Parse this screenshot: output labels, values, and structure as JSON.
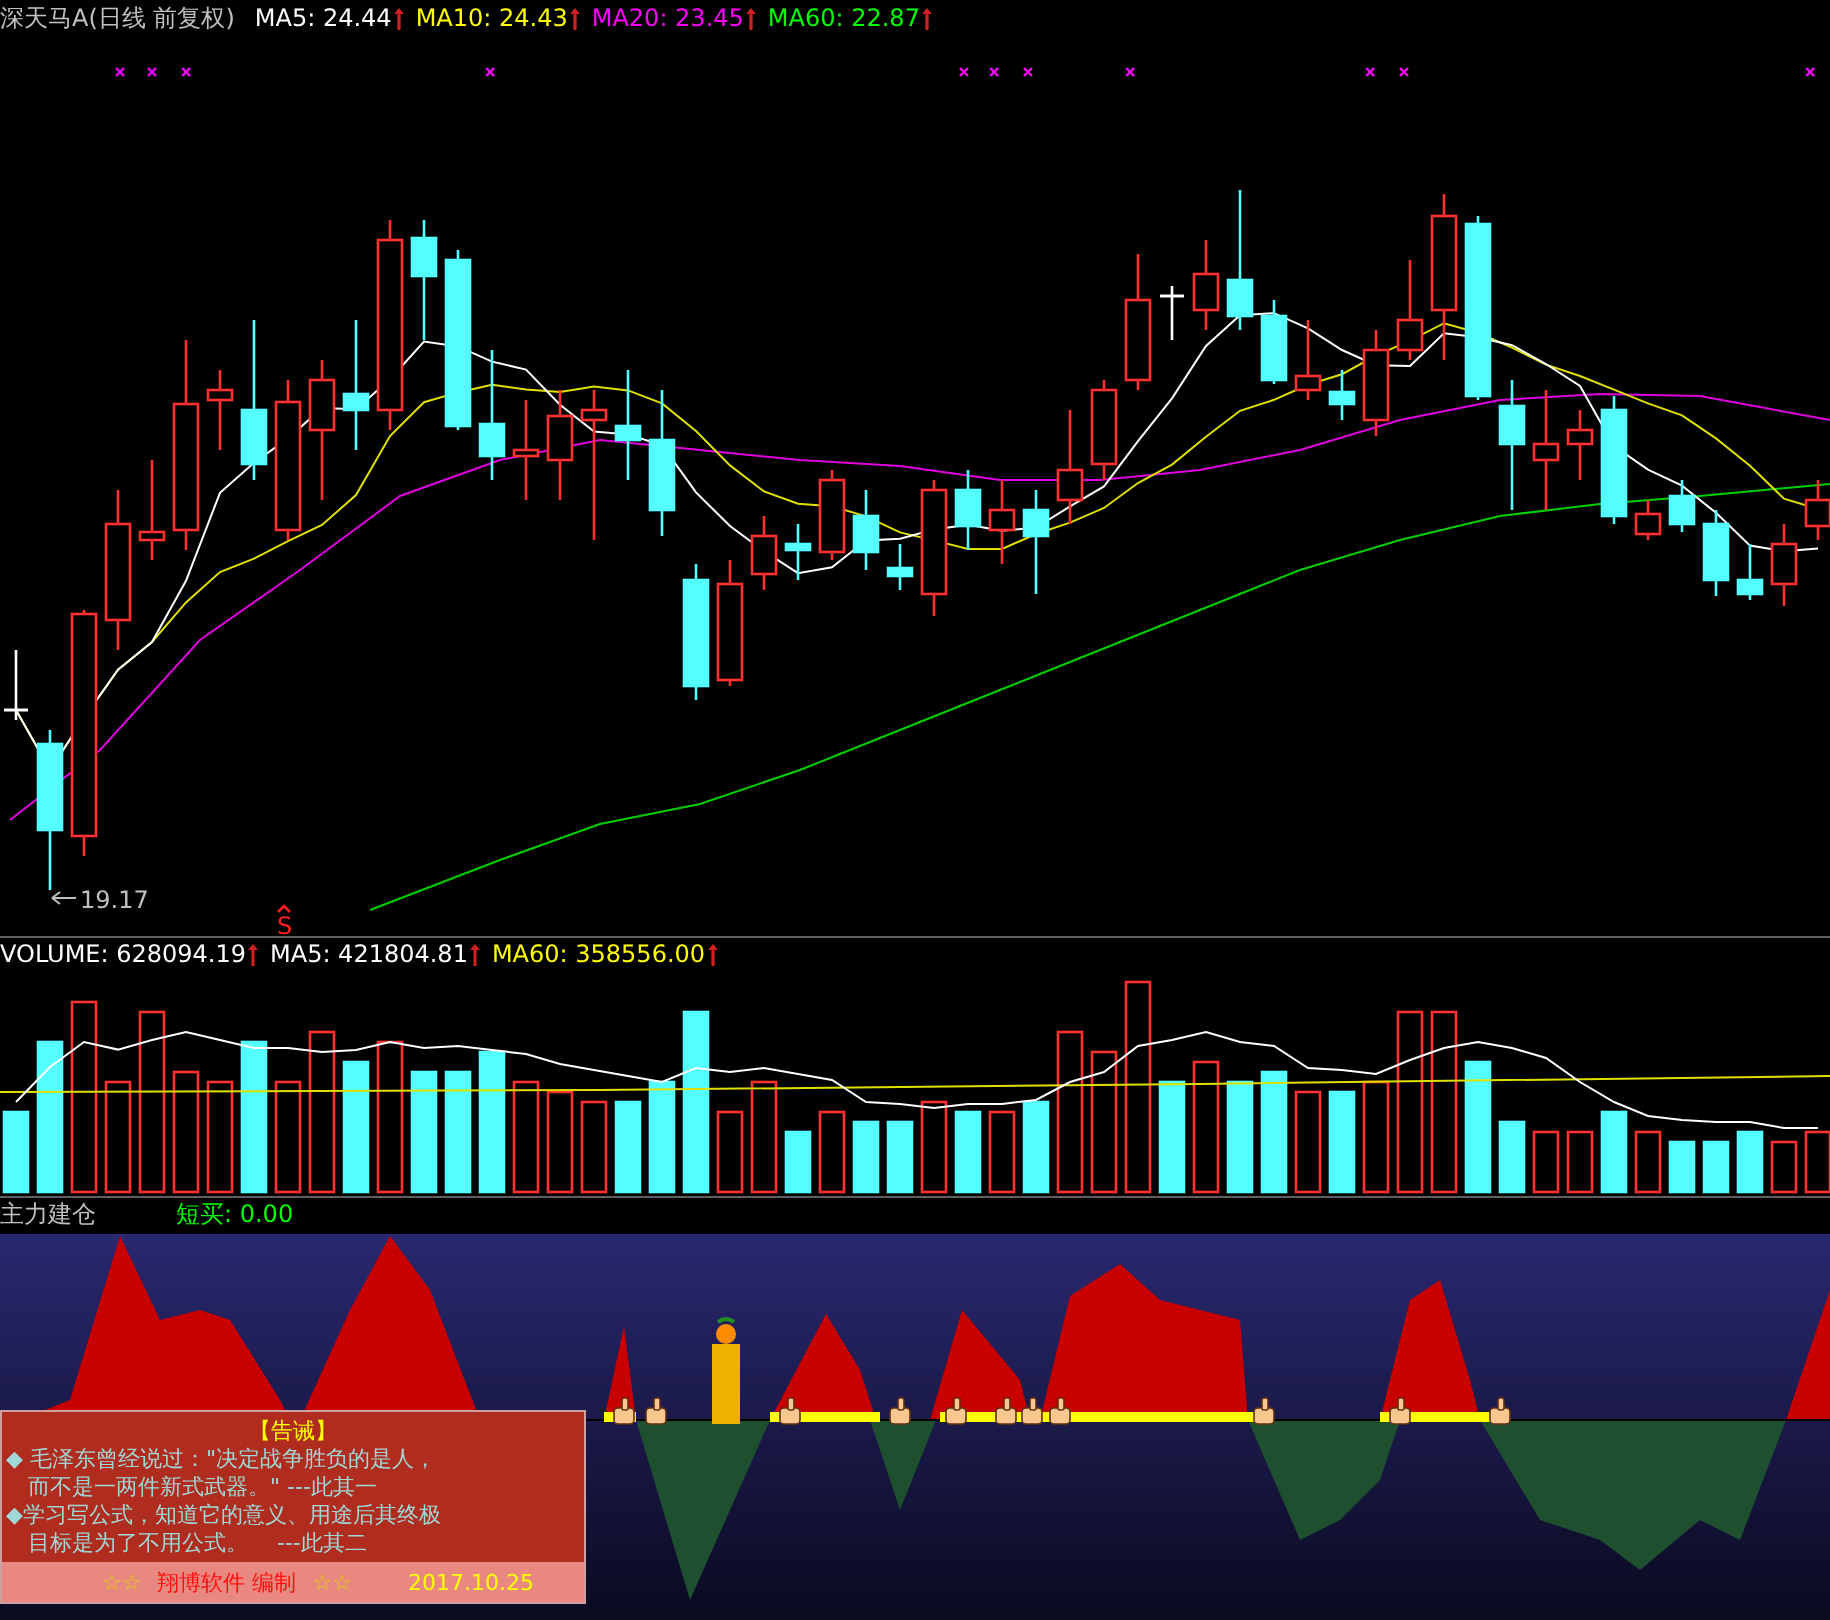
{
  "header": {
    "title": "深天马A(日线 前复权)",
    "averages": [
      {
        "label": "MA5: 24.44",
        "color": "#ffffff"
      },
      {
        "label": "MA10: 24.43",
        "color": "#ffff00"
      },
      {
        "label": "MA20: 23.45",
        "color": "#ff00ff"
      },
      {
        "label": "MA60: 22.87",
        "color": "#00ff00"
      }
    ]
  },
  "price_chart": {
    "low_label": "19.17",
    "signal_label": "S"
  },
  "volume": {
    "averages": [
      {
        "label": "VOLUME: 628094.19",
        "color": "#ffffff"
      },
      {
        "label": "MA5: 421804.81",
        "color": "#ffffff"
      },
      {
        "label": "MA60: 358556.00",
        "color": "#ffff00"
      }
    ]
  },
  "indicator": {
    "title": "主力建仓",
    "reading": "短买: 0.00"
  },
  "notice": {
    "title": "【告诫】",
    "lines": [
      "◆ 毛泽东曾经说过：\"决定战争胜负的是人，",
      "　而不是一两件新式武器。\" ---此其一",
      "◆学习写公式，知道它的意义、用途后其终极",
      "　目标是为了不用公式。　 ---此其二"
    ],
    "footer": {
      "left_stars": "☆☆",
      "credit": "翔博软件 编制",
      "right_stars": "☆☆",
      "date": "2017.10.25"
    }
  }
}
